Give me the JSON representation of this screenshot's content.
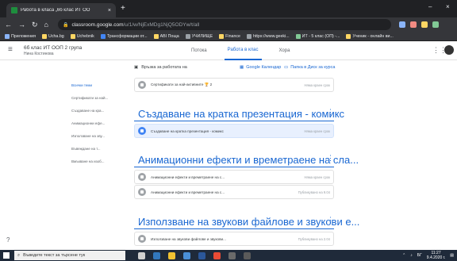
{
  "browser": {
    "tab_title": "Работа в класа „6б клас ИТ ОО",
    "tab_close": "×",
    "new_tab": "+",
    "window_min": "–",
    "window_close": "×",
    "url_domain": "classroom.google.com",
    "url_path": "/u/1/w/NjExMDg1NjQ5ODYw/t/all",
    "bookmarks": [
      "Приложения",
      "Ucha.bg",
      "Uchebnik",
      "Трансформации от...",
      "ABI Поща",
      "УЧИЛИЩЕ",
      "Finance",
      "https://www.geeki...",
      "ИТ - 5 клас (ОП) -...",
      "Ученик - онлайн ви..."
    ]
  },
  "classroom": {
    "class_name": "6б клас ИТ ООП 2 група",
    "teacher_name": "Нина Костинова",
    "tabs": [
      "Потока",
      "Работа в клас",
      "Хора"
    ],
    "meet_label": "Връзка за работата на",
    "calendar_label": "Google Календар",
    "drive_label": "Папка в Диск за курса",
    "sidebar_topics": [
      "Всички теми",
      "Сертификати за най...",
      "Създаване на кра...",
      "Анимационни ефе...",
      "Използване на зву...",
      "Въвеждане на т...",
      "Вмъкване на изоб..."
    ],
    "first_item": {
      "title": "Сертификати за най-активните 🏆 2",
      "date": "Няма краен срок"
    },
    "topics": [
      {
        "title": "Създаване на кратка презентация - комикс",
        "items": [
          {
            "title": "Създаване на кратка презентация - комикс",
            "date": "Няма краен срок"
          }
        ]
      },
      {
        "title": "Анимационни ефекти и времетраене на сла...",
        "items": [
          {
            "title": "Анимационни ефекти и времетраене на с...",
            "date": "Няма краен срок"
          },
          {
            "title": "Анимационни ефекти и времетраене на с...",
            "date": "Публикувано на 9.04"
          }
        ]
      },
      {
        "title": "Използване на звукови файлове и звукови е...",
        "items": [
          {
            "title": "Използване на звукови файлове и звукови...",
            "date": "Публикувано на 2.04"
          }
        ]
      }
    ]
  },
  "taskbar": {
    "search_placeholder": "Въведете текст за търсене тук",
    "lang": "БГ",
    "time": "11:27",
    "date": "9.4.2020 г."
  },
  "colors": {
    "accent": "#1967d2",
    "dark_chrome": "#202124"
  }
}
